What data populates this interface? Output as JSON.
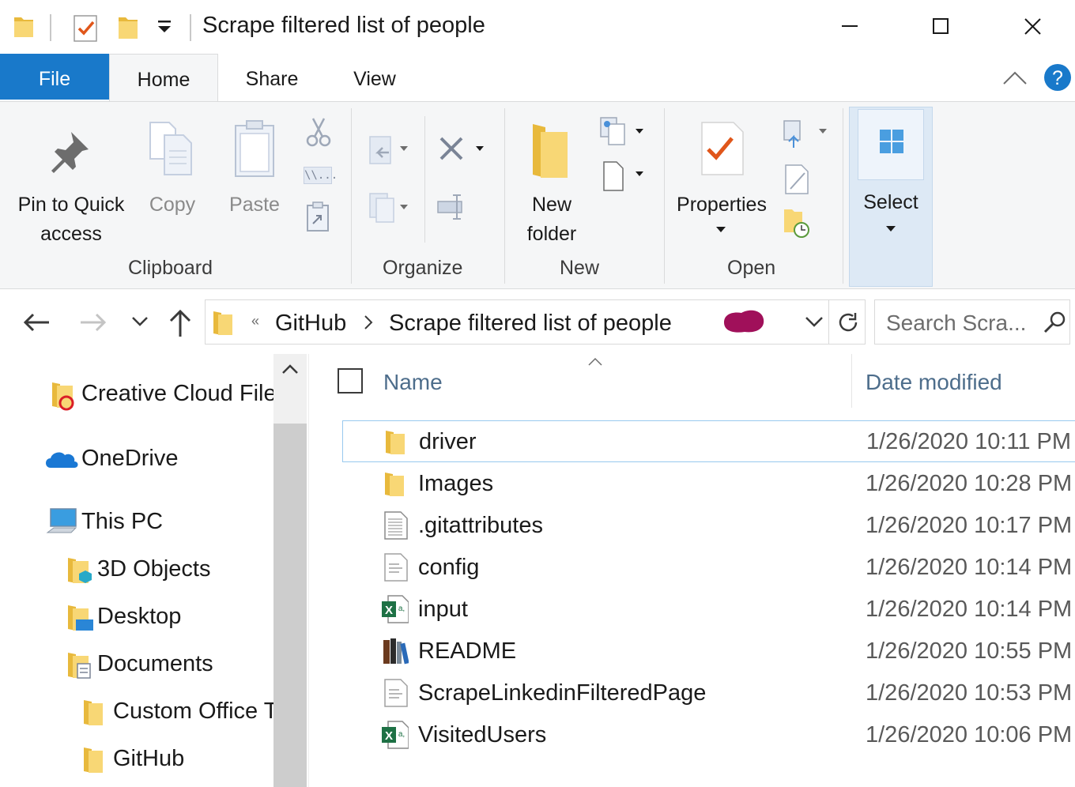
{
  "window": {
    "title": "Scrape filtered list of people"
  },
  "ribbon_tabs": [
    "File",
    "Home",
    "Share",
    "View"
  ],
  "ribbon": {
    "pin_label_1": "Pin to Quick",
    "pin_label_2": "access",
    "copy_label": "Copy",
    "paste_label": "Paste",
    "clipboard_group": "Clipboard",
    "organize_group": "Organize",
    "new_folder_label_1": "New",
    "new_folder_label_2": "folder",
    "new_group": "New",
    "properties_label": "Properties",
    "open_group": "Open",
    "select_label": "Select",
    "copy_path_glyph": "\\\\..."
  },
  "address": {
    "overflow": "«",
    "segments": [
      "GitHub",
      "Scrape filtered list of people"
    ],
    "search_placeholder": "Search Scra..."
  },
  "nav_pane": {
    "items": [
      {
        "label": "Creative Cloud Files",
        "icon": "creative-cloud-folder-icon"
      },
      {
        "label": "OneDrive",
        "icon": "onedrive-cloud-icon"
      },
      {
        "label": "This PC",
        "icon": "this-pc-icon"
      },
      {
        "label": "3D Objects",
        "icon": "3d-objects-folder-icon"
      },
      {
        "label": "Desktop",
        "icon": "desktop-folder-icon"
      },
      {
        "label": "Documents",
        "icon": "documents-folder-icon"
      },
      {
        "label": "Custom Office Templates",
        "icon": "folder-icon"
      },
      {
        "label": "GitHub",
        "icon": "folder-icon"
      }
    ]
  },
  "file_list": {
    "columns": [
      "Name",
      "Date modified"
    ],
    "rows": [
      {
        "name": "driver",
        "date": "1/26/2020 10:11 PM",
        "icon": "folder-icon"
      },
      {
        "name": "Images",
        "date": "1/26/2020 10:28 PM",
        "icon": "folder-icon"
      },
      {
        "name": ".gitattributes",
        "date": "1/26/2020 10:17 PM",
        "icon": "file-icon"
      },
      {
        "name": "config",
        "date": "1/26/2020 10:14 PM",
        "icon": "text-file-icon"
      },
      {
        "name": "input",
        "date": "1/26/2020 10:14 PM",
        "icon": "excel-csv-icon"
      },
      {
        "name": "README",
        "date": "1/26/2020 10:55 PM",
        "icon": "library-books-icon"
      },
      {
        "name": "ScrapeLinkedinFilteredPage",
        "date": "1/26/2020 10:53 PM",
        "icon": "text-file-icon"
      },
      {
        "name": "VisitedUsers",
        "date": "1/26/2020 10:06 PM",
        "icon": "excel-csv-icon"
      }
    ]
  },
  "colors": {
    "file_tab": "#1979ca",
    "ribbon_bg": "#f5f6f7",
    "folder_yellow": "#f8d775",
    "selection_border": "#99c9ef",
    "column_header_text": "#4d6d8b",
    "help_blue": "#1979ca"
  }
}
